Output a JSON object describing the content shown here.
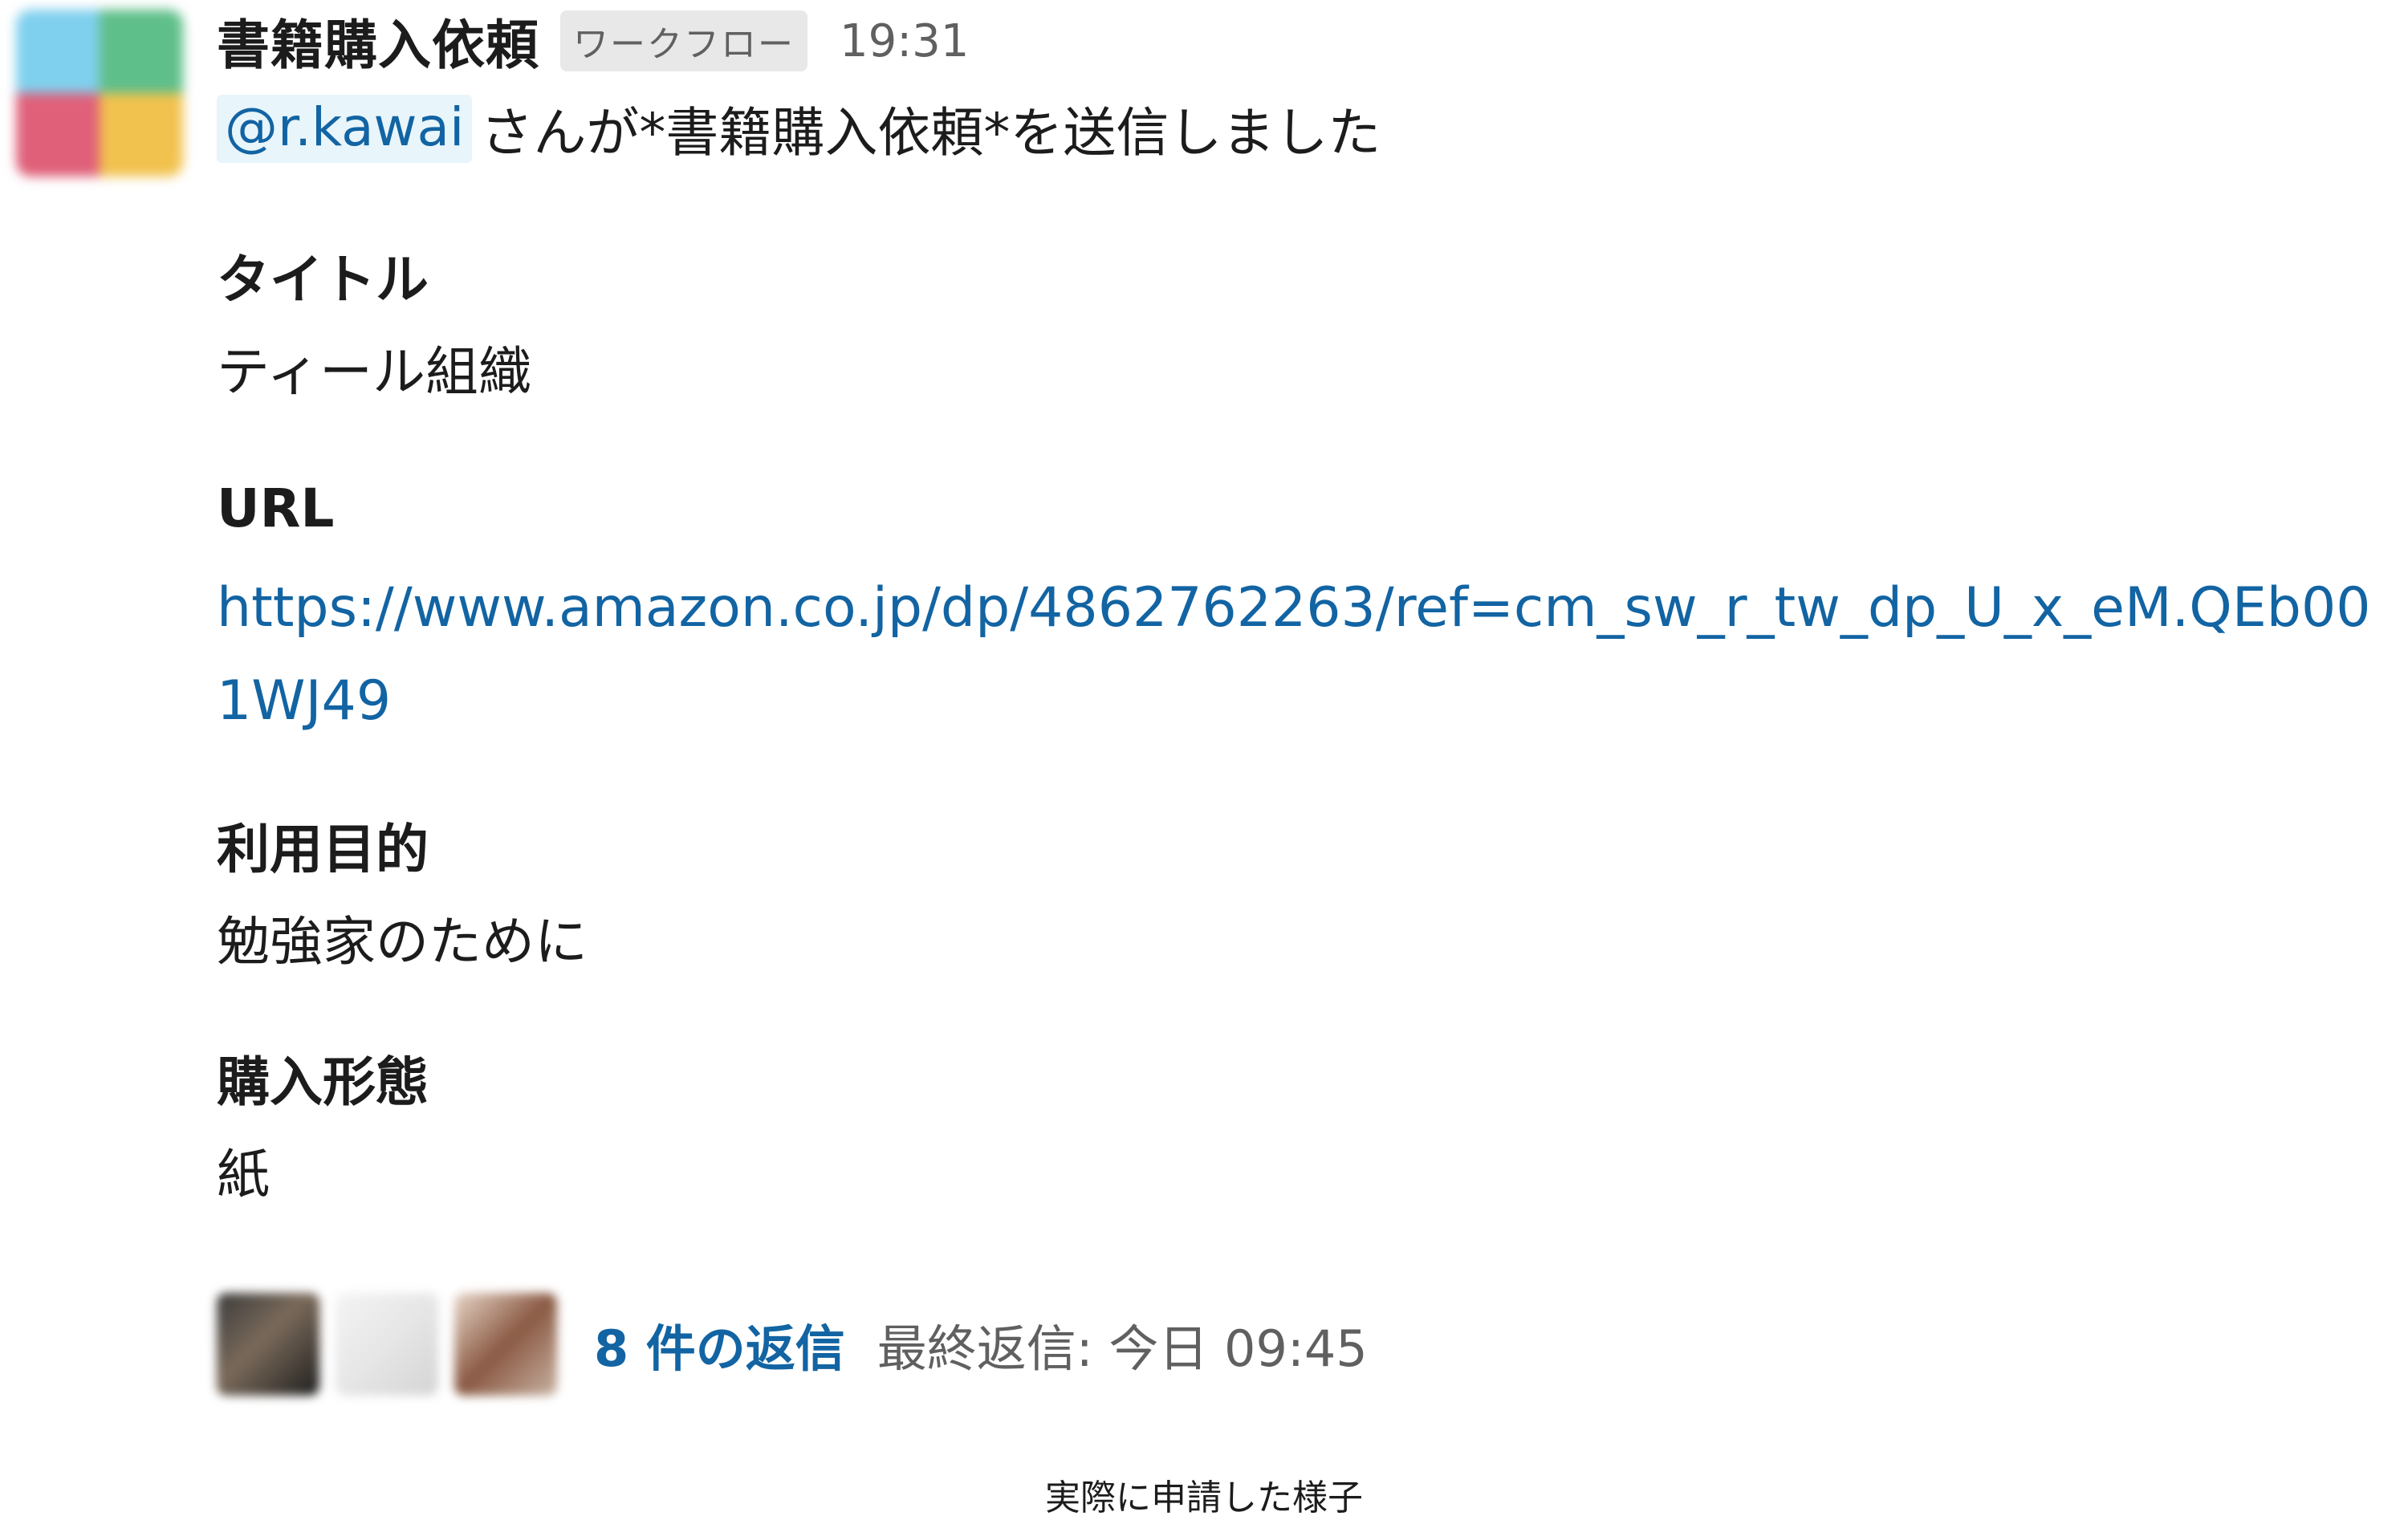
{
  "message": {
    "sender": "書籍購入依頼",
    "badge": "ワークフロー",
    "time": "19:31",
    "mention": "@r.kawai",
    "intro_text": "さんが*書籍購入依頼*を送信しました",
    "fields": [
      {
        "label": "タイトル",
        "value": "ティール組織"
      },
      {
        "label": "URL",
        "value": "https://www.amazon.co.jp/dp/4862762263/ref=cm_sw_r_tw_dp_U_x_eM.QEb001WJ49"
      },
      {
        "label": "利用目的",
        "value": "勉強家のために"
      },
      {
        "label": "購入形態",
        "value": "紙"
      }
    ]
  },
  "thread": {
    "reply_count": "8 件の返信",
    "last_reply": "最終返信: 今日 09:45"
  },
  "caption": "実際に申請した様子",
  "colors": {
    "link": "#1264a3",
    "text": "#1d1c1d",
    "muted": "#616061",
    "badge_bg": "#e8e8e8"
  }
}
